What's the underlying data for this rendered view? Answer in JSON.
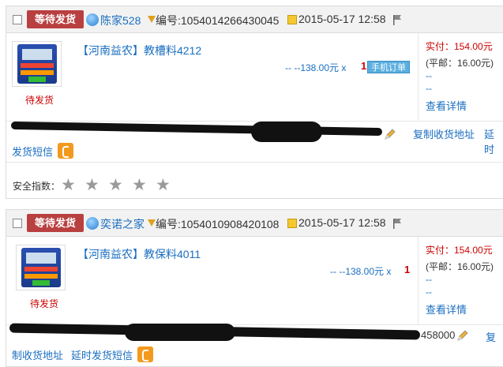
{
  "orders": [
    {
      "status": "等待发货",
      "buyer": "陈家528",
      "order_no": "编号:1054014266430045",
      "date": "2015-05-17 12:58",
      "product": "【河南益农】教槽料4212",
      "price_line": "--  --138.00元 x",
      "qty": "1",
      "mobile_badge": "手机订单",
      "small_status": "待发货",
      "paid": "实付：154.00元",
      "postage": "(平邮：16.00元)",
      "dash1": "--",
      "dash2": "--",
      "detail": "查看详情",
      "copy_addr": "复制收货地址",
      "delay": "延时",
      "sms": "发货短信",
      "safety_label": "安全指数："
    },
    {
      "status": "等待发货",
      "buyer": "奕诺之家",
      "order_no": "编号:1054010908420108",
      "date": "2015-05-17 12:58",
      "product": "【河南益农】教保料4011",
      "price_line": "--  --138.00元 x",
      "qty": "1",
      "small_status": "待发货",
      "paid": "实付：154.00元",
      "postage": "(平邮：16.00元)",
      "dash1": "--",
      "dash2": "--",
      "detail": "查看详情",
      "zip": "458000",
      "copy_prefix": "复",
      "copy_rest": "制收货地址",
      "delay_sms": "延时发货短信"
    }
  ],
  "icons": {
    "wangwang": "wangwang-icon",
    "filter": "funnel-icon",
    "memo": "memo-icon",
    "flag": "flag-icon",
    "phone": "phone-icon",
    "pencil": "pencil-icon",
    "star": "star-icon"
  },
  "colors": {
    "status_badge": "#b94040",
    "link": "#1a6ec0",
    "price_red": "#cc0000",
    "phone_orange": "#f39a1e"
  }
}
